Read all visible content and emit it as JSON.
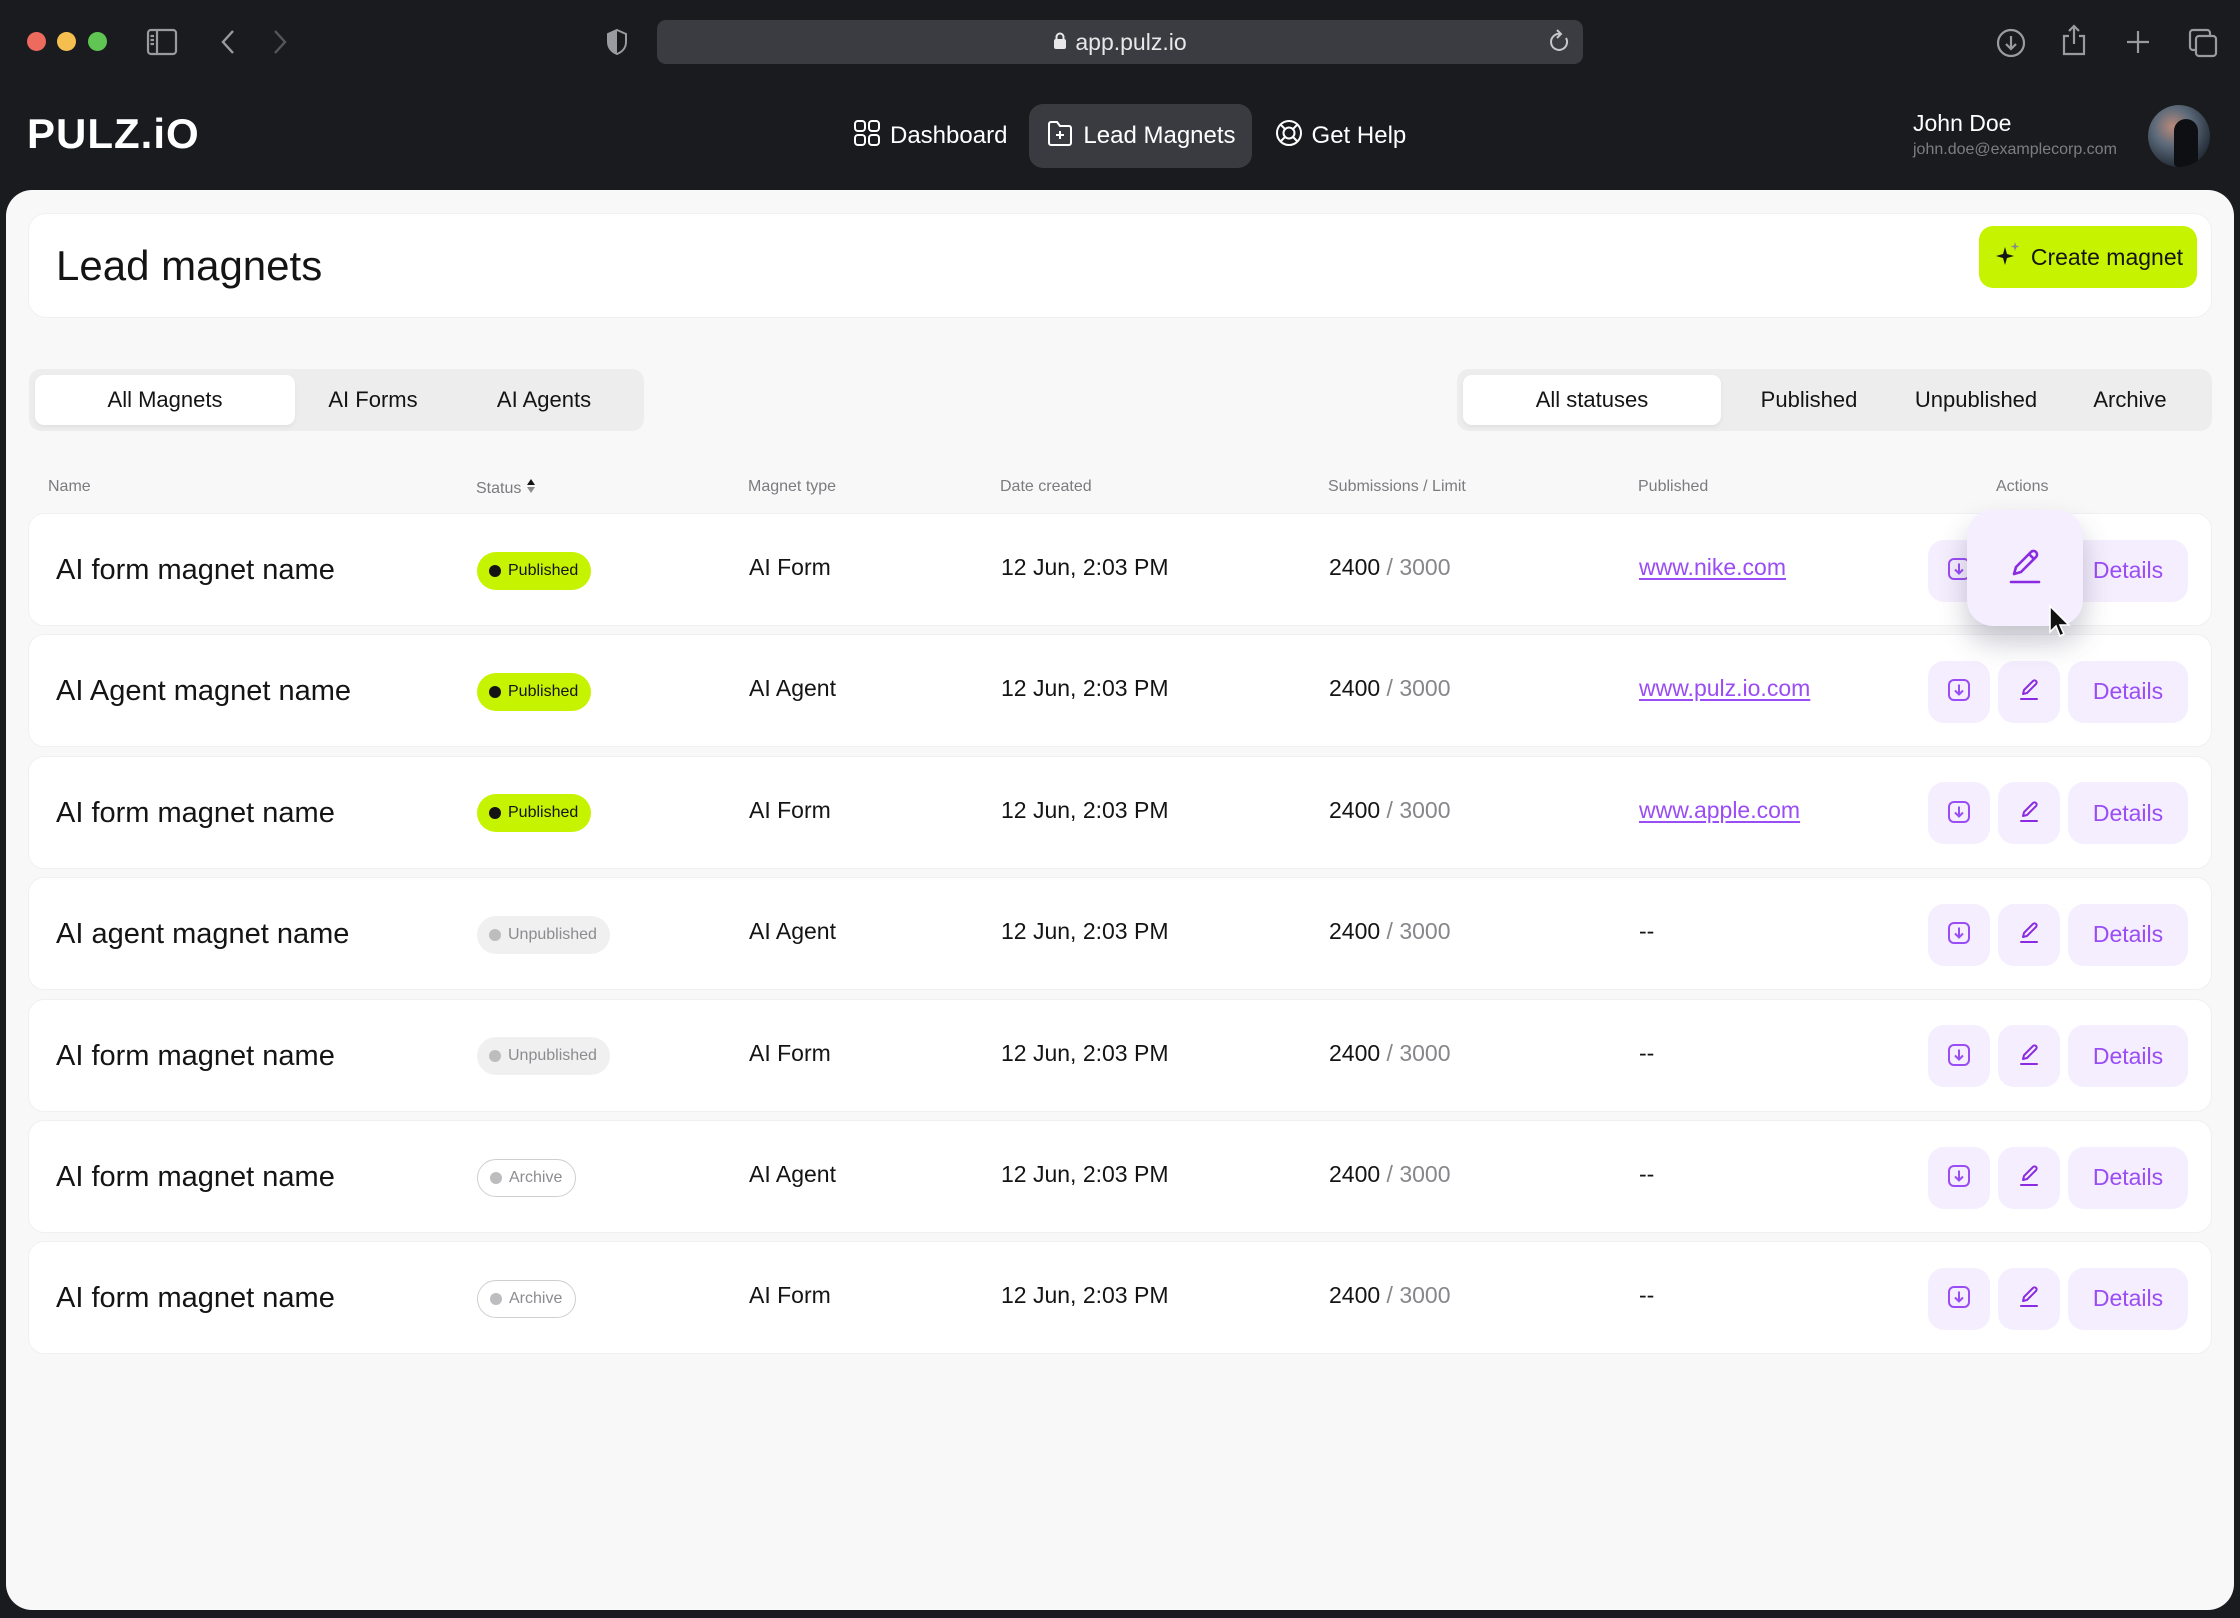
{
  "browser": {
    "url": "app.pulz.io",
    "icons": [
      "sidebar-icon",
      "back-icon",
      "forward-icon",
      "shield-icon",
      "lock-icon",
      "reload-icon",
      "download-icon",
      "share-icon",
      "new-tab-icon",
      "tabs-icon"
    ]
  },
  "app": {
    "logo": "PULZ.iO",
    "nav": [
      {
        "label": "Dashboard",
        "icon": "grid-icon",
        "active": false
      },
      {
        "label": "Lead Magnets",
        "icon": "folder-plus-icon",
        "active": true
      },
      {
        "label": "Get Help",
        "icon": "lifebuoy-icon",
        "active": false
      }
    ],
    "user": {
      "name": "John Doe",
      "email": "john.doe@examplecorp.com"
    }
  },
  "page": {
    "title": "Lead magnets",
    "create_button": "Create magnet"
  },
  "type_tabs": [
    {
      "label": "All Magnets",
      "active": true
    },
    {
      "label": "AI Forms",
      "active": false
    },
    {
      "label": "AI Agents",
      "active": false
    }
  ],
  "status_tabs": [
    {
      "label": "All statuses",
      "active": true
    },
    {
      "label": "Published",
      "active": false
    },
    {
      "label": "Unpublished",
      "active": false
    },
    {
      "label": "Archive",
      "active": false
    }
  ],
  "columns": {
    "name": "Name",
    "status": "Status",
    "type": "Magnet type",
    "date": "Date created",
    "subs": "Submissions / Limit",
    "published": "Published",
    "actions": "Actions"
  },
  "rows": [
    {
      "name": "AI form magnet name",
      "status": "Published",
      "status_kind": "published",
      "type": "AI Form",
      "date": "12 Jun, 2:03 PM",
      "submissions": "2400",
      "limit": "3000",
      "published": "www.nike.com"
    },
    {
      "name": "AI Agent magnet name",
      "status": "Published",
      "status_kind": "published",
      "type": "AI Agent",
      "date": "12 Jun, 2:03 PM",
      "submissions": "2400",
      "limit": "3000",
      "published": "www.pulz.io.com"
    },
    {
      "name": "AI form magnet name",
      "status": "Published",
      "status_kind": "published",
      "type": "AI Form",
      "date": "12 Jun, 2:03 PM",
      "submissions": "2400",
      "limit": "3000",
      "published": "www.apple.com"
    },
    {
      "name": "AI agent magnet name",
      "status": "Unpublished",
      "status_kind": "unpublished",
      "type": "AI Agent",
      "date": "12 Jun, 2:03 PM",
      "submissions": "2400",
      "limit": "3000",
      "published": "--"
    },
    {
      "name": "AI form magnet name",
      "status": "Unpublished",
      "status_kind": "unpublished",
      "type": "AI Form",
      "date": "12 Jun, 2:03 PM",
      "submissions": "2400",
      "limit": "3000",
      "published": "--"
    },
    {
      "name": "AI form magnet name",
      "status": "Archive",
      "status_kind": "archive",
      "type": "AI Agent",
      "date": "12 Jun, 2:03 PM",
      "submissions": "2400",
      "limit": "3000",
      "published": "--"
    },
    {
      "name": "AI form magnet name",
      "status": "Archive",
      "status_kind": "archive",
      "type": "AI Form",
      "date": "12 Jun, 2:03 PM",
      "submissions": "2400",
      "limit": "3000",
      "published": "--"
    }
  ],
  "row_actions": {
    "details_label": "Details",
    "download_icon": "download-icon",
    "edit_icon": "edit-icon"
  },
  "colors": {
    "accent_lime": "#c6f300",
    "accent_purple": "#9a4cf5",
    "action_bg": "#f4eefe",
    "chrome_bg": "#1a1b1e"
  }
}
